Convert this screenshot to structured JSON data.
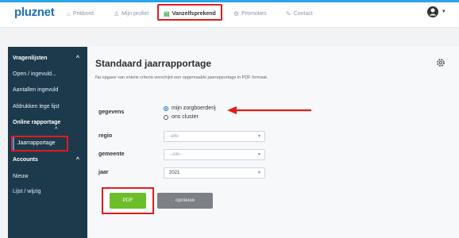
{
  "header": {
    "logo": "pluznet",
    "nav": [
      {
        "label": "Prikbord",
        "icon": "home-icon"
      },
      {
        "label": "Mijn profiel",
        "icon": "user-icon"
      },
      {
        "label": "Vanzelfsprekend",
        "icon": "monitor-icon"
      },
      {
        "label": "Promoties",
        "icon": "gear-icon"
      },
      {
        "label": "Contact",
        "icon": "pencil-icon"
      }
    ],
    "account_caret": "▾"
  },
  "sidebar": {
    "groups": [
      {
        "label": "Vragenlijsten",
        "caret": "^"
      },
      {
        "label": "Online rapportage",
        "caret": "^"
      },
      {
        "label": "Accounts",
        "caret": "^"
      }
    ],
    "items": [
      "Open / ingevuld...",
      "Aantallen ingevuld",
      "Afdrukken lege lijst",
      "Jaarrapportage",
      "Nieuw",
      "Lijst / wijzig"
    ]
  },
  "main": {
    "title": "Standaard jaarrapportage",
    "subtitle": "Na opgave van enkele criteria verschijnt een opgemaakte jaarrapportage in PDF formaat.",
    "fields": {
      "gegevens": {
        "label": "gegevens",
        "options": [
          "mijn zorgboerderij",
          "ons cluster"
        ],
        "selected": "mijn zorgboerderij"
      },
      "regio": {
        "label": "regio",
        "value": "-alle-"
      },
      "gemeente": {
        "label": "gemeente",
        "value": "--alle--"
      },
      "jaar": {
        "label": "jaar",
        "value": "2021"
      }
    },
    "buttons": {
      "pdf": "PDF",
      "reset": "opnieuw"
    },
    "highlight_color": "#e21b1b",
    "accent_color": "#6cbf2b"
  }
}
